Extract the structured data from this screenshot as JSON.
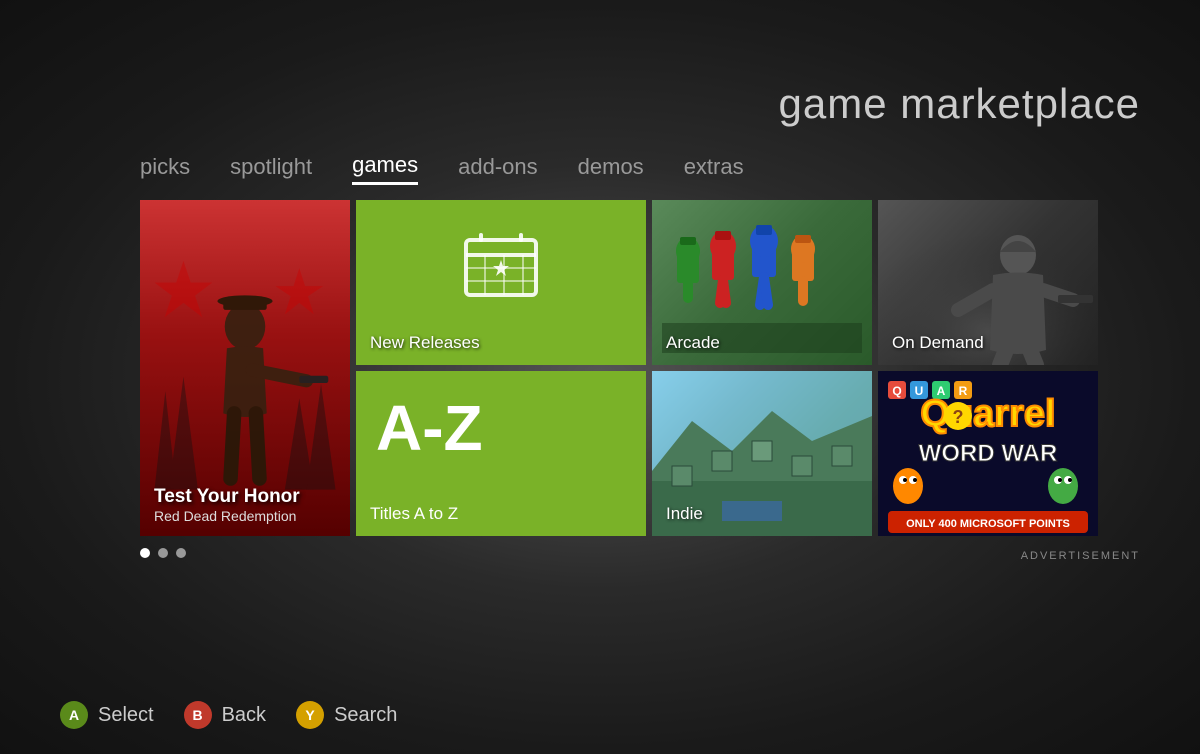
{
  "page": {
    "title": "game marketplace"
  },
  "nav": {
    "items": [
      {
        "id": "picks",
        "label": "picks",
        "active": false
      },
      {
        "id": "spotlight",
        "label": "spotlight",
        "active": false
      },
      {
        "id": "games",
        "label": "games",
        "active": true
      },
      {
        "id": "add-ons",
        "label": "add-ons",
        "active": false
      },
      {
        "id": "demos",
        "label": "demos",
        "active": false
      },
      {
        "id": "extras",
        "label": "extras",
        "active": false
      }
    ]
  },
  "tiles": {
    "new_releases": {
      "label": "New Releases"
    },
    "az": {
      "title": "A-Z",
      "label": "Titles A to Z"
    },
    "rdr": {
      "title": "Test Your Honor",
      "subtitle": "Red Dead Redemption"
    },
    "arcade": {
      "label": "Arcade"
    },
    "ondemand": {
      "label": "On Demand"
    },
    "indie": {
      "label": "Indie"
    },
    "quarrel": {
      "title": "Quarrel",
      "subtitle": "WORD WAR",
      "points": "ONLY 400 MICROSOFT POINTS"
    }
  },
  "dots": [
    {
      "active": true
    },
    {
      "active": false
    },
    {
      "active": false
    }
  ],
  "ad_label": "ADVERTISEMENT",
  "buttons": [
    {
      "id": "a",
      "key": "A",
      "label": "Select",
      "color": "btn-a"
    },
    {
      "id": "b",
      "key": "B",
      "label": "Back",
      "color": "btn-b"
    },
    {
      "id": "y",
      "key": "Y",
      "label": "Search",
      "color": "btn-y"
    }
  ]
}
